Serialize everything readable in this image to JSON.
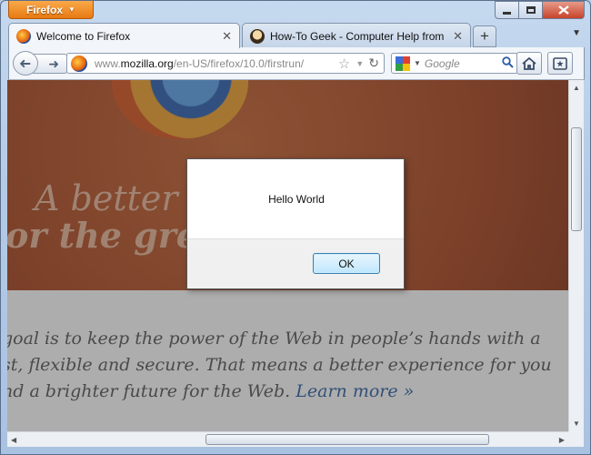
{
  "app_menu": {
    "label": "Firefox"
  },
  "tabs": [
    {
      "title": "Welcome to Firefox"
    },
    {
      "title": "How-To Geek - Computer Help from ..."
    }
  ],
  "navbar": {
    "url_prefix": "www.",
    "url_domain": "mozilla.org",
    "url_path": "/en-US/firefox/10.0/firstrun/",
    "search_placeholder": "Google"
  },
  "page": {
    "hero_line1": "A better w",
    "hero_line2": "or the gre",
    "body_lines": [
      "goal is to keep the power of the Web in people’s hands with a",
      "st, flexible and secure. That means a better experience for you",
      "nd a brighter future for the Web."
    ],
    "learn_more": "Learn more »"
  },
  "dialog": {
    "message": "Hello World",
    "ok_label": "OK"
  },
  "colors": {
    "app_button": "#e77a12",
    "hero_background": "#a9431c",
    "link": "#2d5da2"
  }
}
